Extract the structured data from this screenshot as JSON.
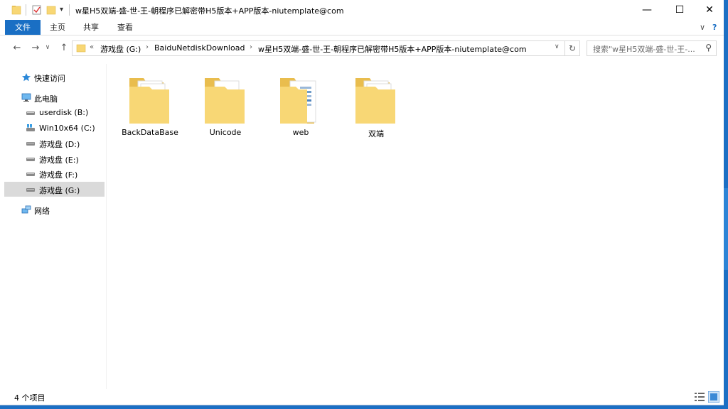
{
  "window": {
    "title": "w星H5双端-盛-世-王-朝程序已解密带H5版本+APP版本-niutemplate@com",
    "qa_dropdown": "▾",
    "controls": {
      "minimize": "—",
      "maximize": "☐",
      "close": "✕"
    }
  },
  "ribbon": {
    "tabs": [
      {
        "label": "文件"
      },
      {
        "label": "主页"
      },
      {
        "label": "共享"
      },
      {
        "label": "查看"
      }
    ],
    "collapse": "∨",
    "help": "?"
  },
  "nav": {
    "back": "←",
    "forward": "→",
    "recent": "∨",
    "up": "↑",
    "address": {
      "prefix": "«",
      "segments": [
        "游戏盘 (G:)",
        "BaiduNetdiskDownload",
        "w星H5双端-盛-世-王-朝程序已解密带H5版本+APP版本-niutemplate@com"
      ],
      "sep": "›",
      "dropdown": "∨"
    },
    "refresh": "↻",
    "search_placeholder": "搜索\"w星H5双端-盛-世-王-..."
  },
  "sidebar": {
    "items": [
      {
        "label": "快速访问",
        "icon": "star-icon"
      },
      {
        "label": "此电脑",
        "icon": "computer-icon"
      },
      {
        "label": "userdisk (B:)",
        "icon": "drive-icon"
      },
      {
        "label": "Win10x64 (C:)",
        "icon": "windows-drive-icon"
      },
      {
        "label": "游戏盘 (D:)",
        "icon": "drive-icon"
      },
      {
        "label": "游戏盘 (E:)",
        "icon": "drive-icon"
      },
      {
        "label": "游戏盘 (F:)",
        "icon": "drive-icon"
      },
      {
        "label": "游戏盘 (G:)",
        "icon": "drive-icon",
        "selected": true
      },
      {
        "label": "网络",
        "icon": "network-icon"
      }
    ]
  },
  "content": {
    "folders": [
      {
        "name": "BackDataBase",
        "icon": "folder-icon"
      },
      {
        "name": "Unicode",
        "icon": "folder-icon"
      },
      {
        "name": "web",
        "icon": "folder-icon"
      },
      {
        "name": "双端",
        "icon": "folder-icon"
      }
    ]
  },
  "status": {
    "count_text": "4 个项目"
  },
  "colors": {
    "accent": "#1a6fc4",
    "folder": "#f8d775",
    "selected": "#dadada"
  }
}
